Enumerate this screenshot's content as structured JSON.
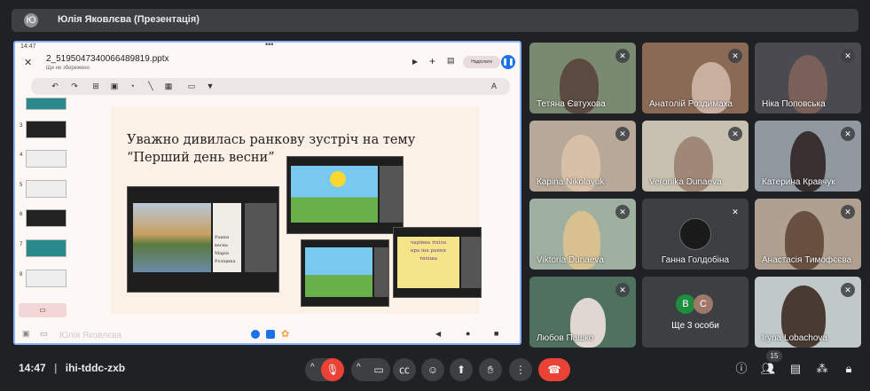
{
  "topbar": {
    "avatar_letter": "Ю",
    "title": "Юлія Яковлєва (Презентація)"
  },
  "presentation": {
    "status_time": "14:47",
    "filename": "2_5195047340066489819.pptx",
    "save_state": "Ще не збережено",
    "share_label": "Надіслати",
    "thumb_numbers": [
      "3",
      "4",
      "5",
      "6",
      "7",
      "8"
    ],
    "slide_title": "Уважно дивилась ранкову зустріч на тему “Перший день весни”",
    "inner_caption": "Рання весна\nМарія Розіцина",
    "inner_poem": "чарівна тіхіла кра іна рання тихіша",
    "presenter_name": "Юлія Яковлєва"
  },
  "participants": [
    {
      "name": "Тетяна Євтухова",
      "bg": "#7a8a70"
    },
    {
      "name": "Анатолій Роздимаха",
      "bg": "#8a6a55"
    },
    {
      "name": "Ніка Поповська",
      "bg": "#4a4a50"
    },
    {
      "name": "Карina Nikolayuk",
      "bg": "#b8a898"
    },
    {
      "name": "Veronika Dunaeva",
      "bg": "#c8c0b0"
    },
    {
      "name": "Катерина Кравчук",
      "bg": "#9098a0"
    },
    {
      "name": "Viktoria Dunaeva",
      "bg": "#a0b0a0"
    },
    {
      "name": "Ганна Голдобіна",
      "bg": "#3c4043"
    },
    {
      "name": "Анастасія Тимофєєва",
      "bg": "#b0a090"
    },
    {
      "name": "Любов Пашко",
      "bg": "#507060"
    },
    {
      "name": "Ще 3 особи",
      "bg": "#3c4043"
    },
    {
      "name": "Iryna Lobachova",
      "bg": "#c0c8c8"
    }
  ],
  "more_avatars": [
    "B",
    "C"
  ],
  "meeting": {
    "time": "14:47",
    "code": "ihi-tddc-zxb",
    "participant_count": "15"
  },
  "colors": {
    "accent": "#8ab4f8",
    "end_call": "#ea4335",
    "mic_off": "#ea4335"
  }
}
